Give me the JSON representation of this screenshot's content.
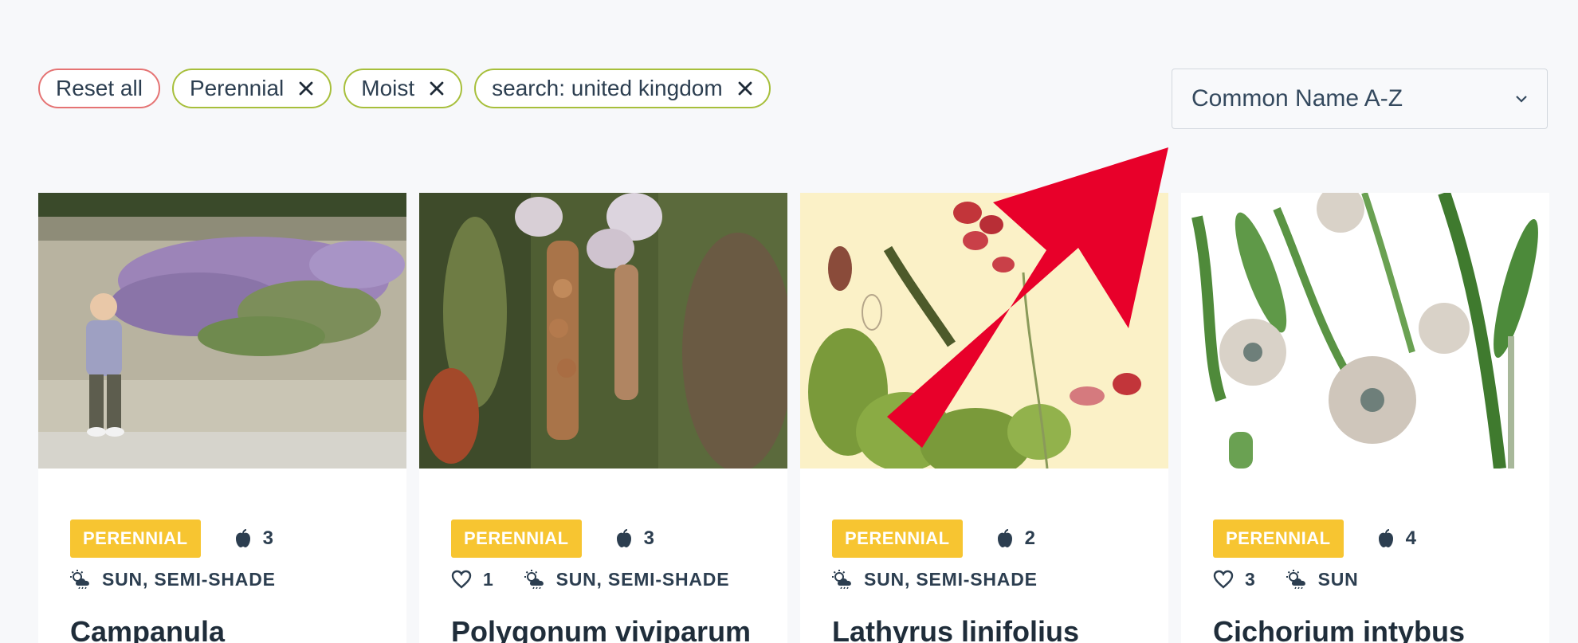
{
  "filters": {
    "reset_label": "Reset all",
    "chips": [
      {
        "label": "Perennial"
      },
      {
        "label": "Moist"
      },
      {
        "label": "search: united kingdom"
      }
    ]
  },
  "sort": {
    "selected": "Common Name A-Z"
  },
  "cards": [
    {
      "badge": "PERENNIAL",
      "fruit_count": "3",
      "likes": "",
      "light": "SUN, SEMI-SHADE",
      "title": "Campanula"
    },
    {
      "badge": "PERENNIAL",
      "fruit_count": "3",
      "likes": "1",
      "light": "SUN, SEMI-SHADE",
      "title": "Polygonum viviparum"
    },
    {
      "badge": "PERENNIAL",
      "fruit_count": "2",
      "likes": "",
      "light": "SUN, SEMI-SHADE",
      "title": "Lathyrus linifolius"
    },
    {
      "badge": "PERENNIAL",
      "fruit_count": "4",
      "likes": "3",
      "light": "SUN",
      "title": "Cichorium intybus"
    }
  ],
  "colors": {
    "chip_border": "#a7bf3b",
    "reset_border": "#e57373",
    "badge": "#f7c531",
    "arrow": "#e8002a"
  }
}
